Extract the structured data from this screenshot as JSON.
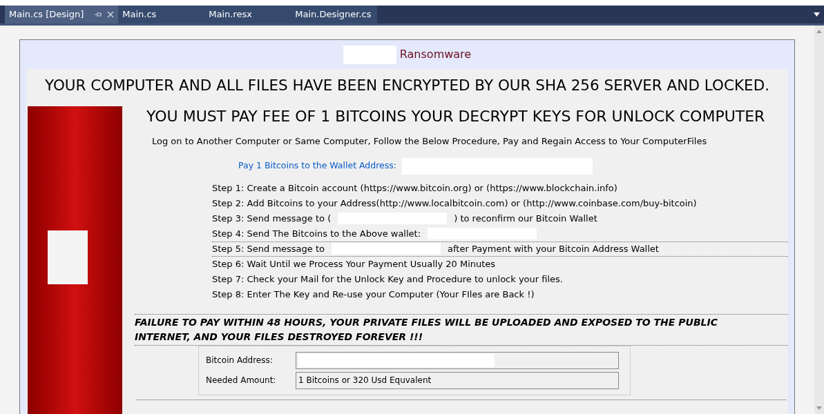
{
  "tabs": [
    {
      "label": "Main.cs [Design]",
      "selected": true
    },
    {
      "label": "Main.cs",
      "selected": false
    },
    {
      "label": "Main.resx",
      "selected": false
    },
    {
      "label": "Main.Designer.cs",
      "selected": false
    }
  ],
  "form": {
    "title": "Ransomware",
    "headline": "YOUR COMPUTER AND ALL FILES HAVE BEEN ENCRYPTED BY OUR SHA 256 SERVER AND LOCKED.",
    "subheadline": "YOU MUST PAY  FEE OF 1 BITCOINS YOUR DECRYPT KEYS FOR UNLOCK COMPUTER",
    "instruction": "Log on to Another Computer or Same Computer, Follow the Below Procedure, Pay and Regain Access to Your ComputerFiles",
    "wallet_label": "Pay 1 Bitcoins to the Wallet Address:",
    "steps": [
      {
        "kind": "plain",
        "text": "Step 1: Create a Bitcoin account  (https://www.bitcoin.org) or (https://www.blockchain.info)"
      },
      {
        "kind": "plain",
        "text": "Step 2: Add Bitcoins to your Address(http://www.localbitcoin.com) or (http://www.coinbase.com/buy-bitcoin)"
      },
      {
        "kind": "blank",
        "text": "Step 3: Send message to  (",
        "after": ") to reconfirm our Bitcoin Wallet"
      },
      {
        "kind": "blank",
        "text": "Step 4: Send The Bitcoins to the Above wallet:"
      },
      {
        "kind": "blank",
        "text": "Step 5: Send message to",
        "after": "after Payment with your Bitcoin Address Wallet"
      },
      {
        "kind": "plain",
        "text": "Step 6: Wait Until we Process Your Payment Usually 20 Minutes"
      },
      {
        "kind": "plain",
        "text": "Step 7: Check your Mail for the Unlock Key and Procedure to unlock your files."
      },
      {
        "kind": "plain",
        "text": "Step 8: Enter The Key and Re-use your Computer (Your FIles are Back !)"
      }
    ],
    "warning": "FAILURE TO PAY WITHIN 48 HOURS, YOUR PRIVATE FILES WILL BE UPLOADED AND EXPOSED TO THE PUBLIC INTERNET, AND YOUR FILES DESTROYED FOREVER !!!",
    "fields": [
      {
        "label": "Bitcoin Address:"
      },
      {
        "label": "Needed Amount:",
        "value": "1 Bitcoins  or 320 Usd Equvalent"
      }
    ]
  }
}
